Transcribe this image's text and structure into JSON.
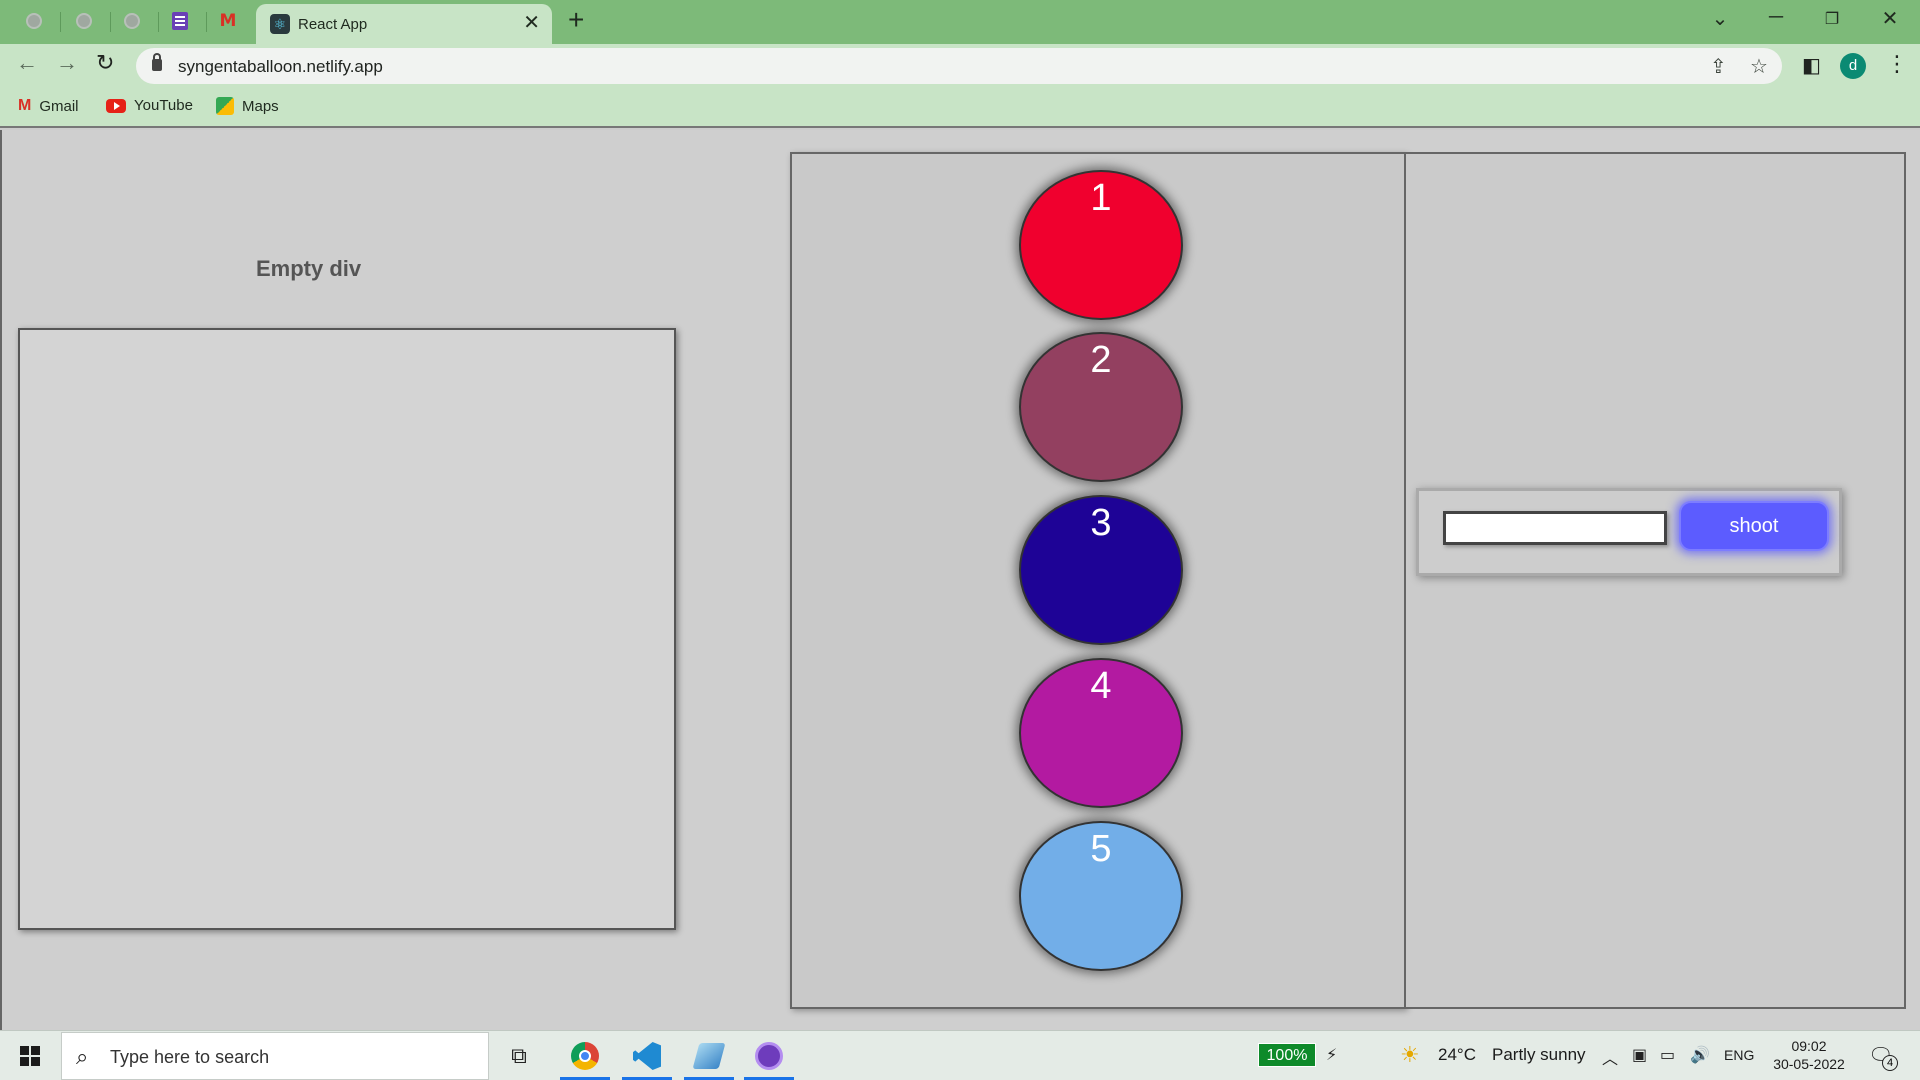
{
  "browser": {
    "active_tab_title": "React App",
    "url": "syngentaballoon.netlify.app",
    "profile_initial": "d",
    "bookmarks": [
      {
        "label": "Gmail"
      },
      {
        "label": "YouTube"
      },
      {
        "label": "Maps"
      }
    ]
  },
  "page": {
    "empty_heading": "Empty div",
    "balloons": [
      {
        "number": "1",
        "color": "#f0002e"
      },
      {
        "number": "2",
        "color": "#934060"
      },
      {
        "number": "3",
        "color": "#1e0396"
      },
      {
        "number": "4",
        "color": "#b31aa1"
      },
      {
        "number": "5",
        "color": "#72aee8"
      }
    ],
    "shoot_input_value": "",
    "shoot_button_label": "shoot"
  },
  "taskbar": {
    "search_placeholder": "Type here to search",
    "battery_percent": "100%",
    "weather_temp": "24°C",
    "weather_text": "Partly sunny",
    "language": "ENG",
    "time": "09:02",
    "date": "30-05-2022",
    "notification_count": "4"
  }
}
